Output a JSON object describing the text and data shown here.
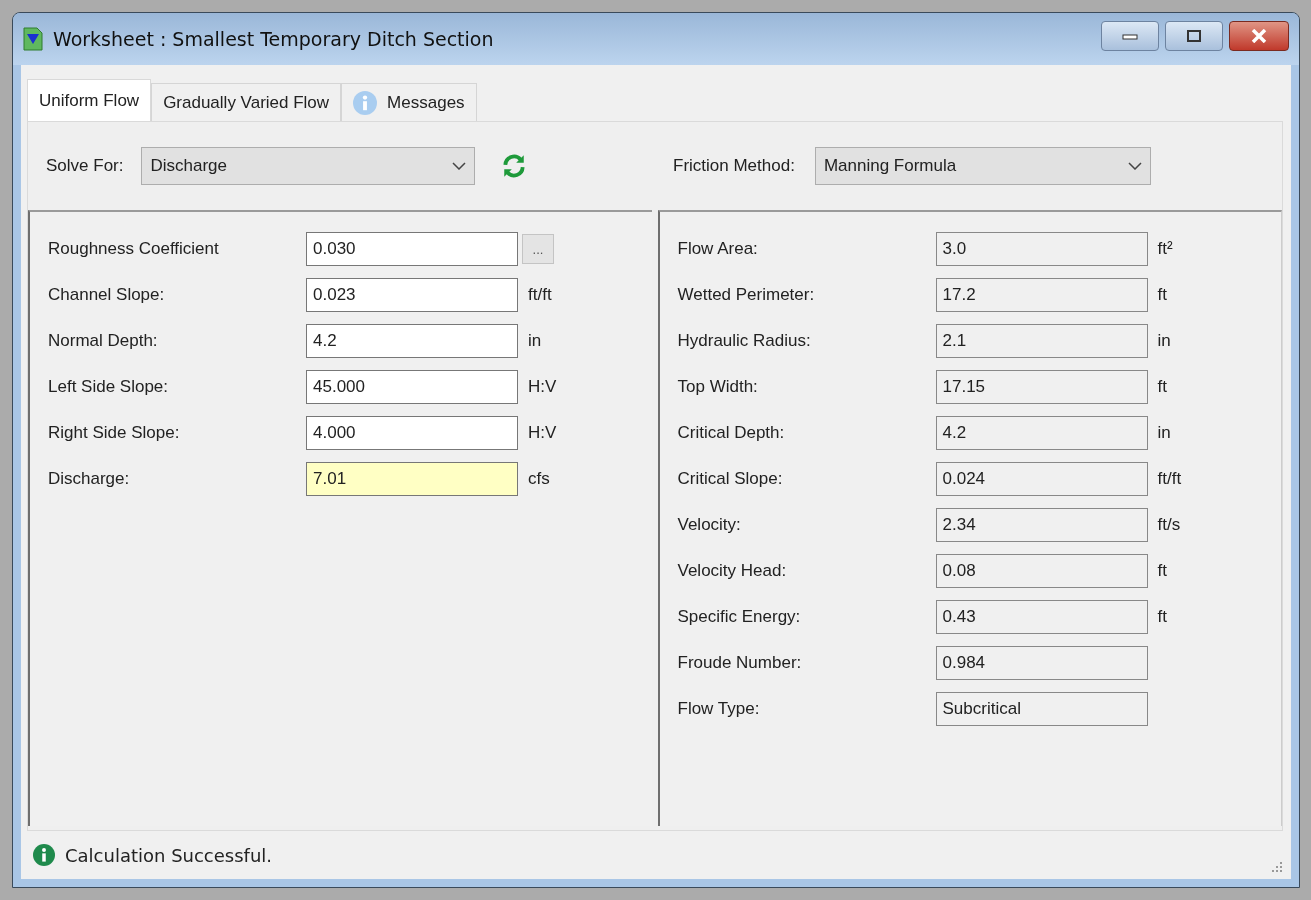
{
  "window": {
    "title": "Worksheet : Smallest Temporary Ditch Section"
  },
  "tabs": [
    {
      "label": "Uniform Flow",
      "selected": true,
      "kind": "plain"
    },
    {
      "label": "Gradually Varied Flow",
      "selected": false,
      "kind": "plain"
    },
    {
      "label": "Messages",
      "selected": false,
      "kind": "info"
    }
  ],
  "solve_for": {
    "label": "Solve For:",
    "value": "Discharge"
  },
  "friction_method": {
    "label": "Friction Method:",
    "value": "Manning Formula"
  },
  "inputs": [
    {
      "label": "Roughness Coefficient",
      "value": "0.030",
      "button": "...",
      "highlighted": false
    },
    {
      "label": "Channel Slope:",
      "value": "0.023",
      "unit": "ft/ft",
      "highlighted": false
    },
    {
      "label": "Normal Depth:",
      "value": "4.2",
      "unit": "in",
      "highlighted": false
    },
    {
      "label": "Left Side Slope:",
      "value": "45.000",
      "unit": "H:V",
      "highlighted": false
    },
    {
      "label": "Right Side Slope:",
      "value": "4.000",
      "unit": "H:V",
      "highlighted": false
    },
    {
      "label": "Discharge:",
      "value": "7.01",
      "unit": "cfs",
      "highlighted": true
    }
  ],
  "results": [
    {
      "label": "Flow Area:",
      "value": "3.0",
      "unit": "ft²"
    },
    {
      "label": "Wetted Perimeter:",
      "value": "17.2",
      "unit": "ft"
    },
    {
      "label": "Hydraulic Radius:",
      "value": "2.1",
      "unit": "in"
    },
    {
      "label": "Top Width:",
      "value": "17.15",
      "unit": "ft"
    },
    {
      "label": "Critical Depth:",
      "value": "4.2",
      "unit": "in"
    },
    {
      "label": "Critical Slope:",
      "value": "0.024",
      "unit": "ft/ft"
    },
    {
      "label": "Velocity:",
      "value": "2.34",
      "unit": "ft/s"
    },
    {
      "label": "Velocity Head:",
      "value": "0.08",
      "unit": "ft"
    },
    {
      "label": "Specific Energy:",
      "value": "0.43",
      "unit": "ft"
    },
    {
      "label": "Froude Number:",
      "value": "0.984"
    },
    {
      "label": "Flow Type:",
      "value": "Subcritical"
    }
  ],
  "status_bar": {
    "text": "Calculation Successful."
  }
}
